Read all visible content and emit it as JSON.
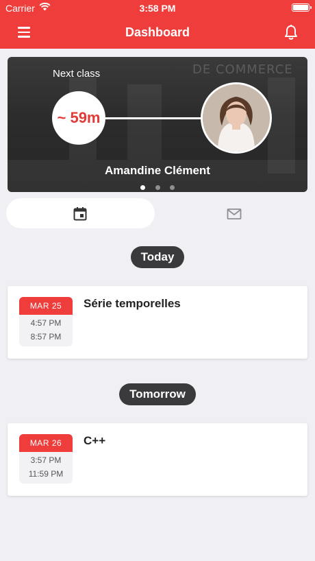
{
  "status_bar": {
    "carrier": "Carrier",
    "time": "3:58 PM"
  },
  "header": {
    "title": "Dashboard",
    "background_color": "#ef3d3b"
  },
  "hero": {
    "label": "Next class",
    "countdown": "~ 59m",
    "teacher_name": "Amandine Clément",
    "background_text": "DE COMMERCE",
    "pages": 3,
    "active_page": 1
  },
  "tabs": [
    {
      "name": "calendar",
      "icon": "calendar-icon",
      "selected": true
    },
    {
      "name": "messages",
      "icon": "mail-icon",
      "selected": false
    }
  ],
  "sections": [
    {
      "label": "Today",
      "events": [
        {
          "date": "MAR 25",
          "start": "4:57 PM",
          "end": "8:57 PM",
          "title": "Série temporelles"
        }
      ]
    },
    {
      "label": "Tomorrow",
      "events": [
        {
          "date": "MAR 26",
          "start": "3:57 PM",
          "end": "11:59 PM",
          "title": "C++"
        }
      ]
    }
  ]
}
